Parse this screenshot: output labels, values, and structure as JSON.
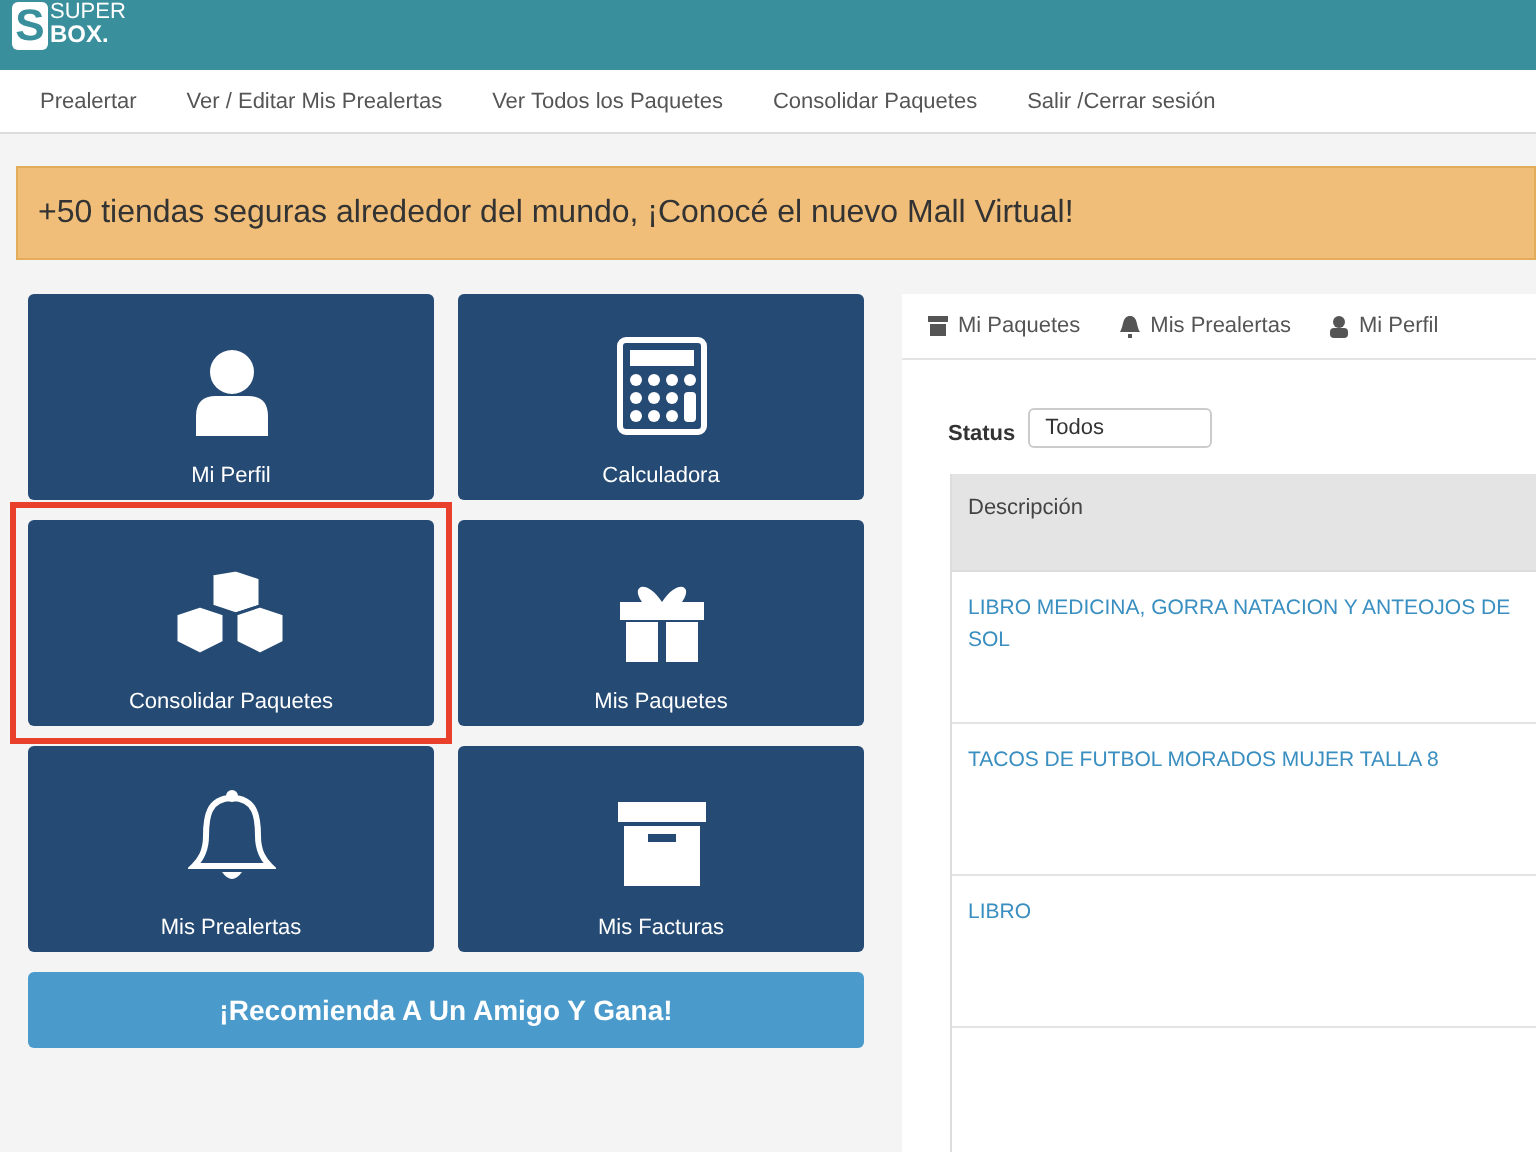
{
  "logo": {
    "mark": "S",
    "line1": "SUPER",
    "line2": "BOX."
  },
  "nav": [
    "Prealertar",
    "Ver / Editar Mis Prealertas",
    "Ver Todos los Paquetes",
    "Consolidar Paquetes",
    "Salir /Cerrar sesión"
  ],
  "banner": "+50 tiendas seguras alrededor del mundo, ¡Conocé el nuevo Mall Virtual!",
  "tiles": [
    {
      "label": "Mi Perfil",
      "kind": "person",
      "highlighted": false
    },
    {
      "label": "Calculadora",
      "kind": "calculator",
      "highlighted": false
    },
    {
      "label": "Consolidar Paquetes",
      "kind": "cubes",
      "highlighted": true
    },
    {
      "label": "Mis Paquetes",
      "kind": "gift",
      "highlighted": false
    },
    {
      "label": "Mis Prealertas",
      "kind": "bell",
      "highlighted": false
    },
    {
      "label": "Mis Facturas",
      "kind": "archive",
      "highlighted": false
    }
  ],
  "referral_button": "¡Recomienda A Un Amigo Y Gana!",
  "tabs": [
    {
      "label": "Mi Paquetes",
      "kind": "archive"
    },
    {
      "label": "Mis Prealertas",
      "kind": "bell"
    },
    {
      "label": "Mi Perfil",
      "kind": "person"
    }
  ],
  "status": {
    "label": "Status",
    "value": "Todos"
  },
  "table": {
    "columns": [
      "Descripción"
    ],
    "rows": [
      "LIBRO MEDICINA, GORRA NATACION Y ANTEOJOS DE SOL",
      "TACOS DE FUTBOL MORADOS MUJER TALLA 8",
      "LIBRO",
      ""
    ]
  }
}
